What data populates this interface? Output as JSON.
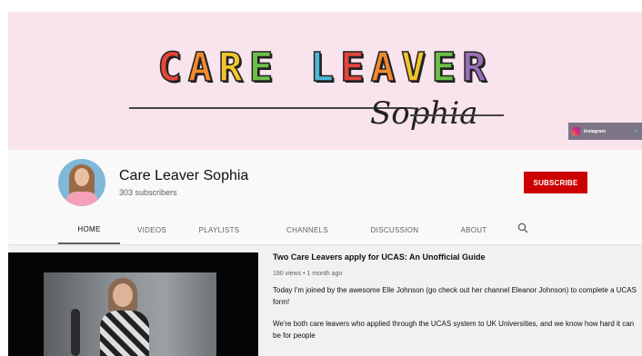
{
  "banner": {
    "title_letters": [
      {
        "char": "C",
        "color": "#e5453b"
      },
      {
        "char": "A",
        "color": "#f28a2e"
      },
      {
        "char": "R",
        "color": "#f2c52c"
      },
      {
        "char": "E",
        "color": "#6cc04a"
      },
      {
        "char": " ",
        "color": "#000000"
      },
      {
        "char": "L",
        "color": "#4fb7d8"
      },
      {
        "char": "E",
        "color": "#e5453b"
      },
      {
        "char": "A",
        "color": "#f28a2e"
      },
      {
        "char": "V",
        "color": "#f2c52c"
      },
      {
        "char": "E",
        "color": "#6cc04a"
      },
      {
        "char": "R",
        "color": "#9a6fb8"
      }
    ],
    "signature": "Sophia",
    "background": "#f9e3ed"
  },
  "social": {
    "instagram_label": "Instagram",
    "icons": [
      "instagram-icon",
      "twitter-icon"
    ]
  },
  "channel": {
    "name": "Care Leaver Sophia",
    "subscribers": "303 subscribers",
    "subscribe_label": "SUBSCRIBE",
    "subscribe_color": "#cc0000"
  },
  "tabs": [
    {
      "label": "HOME",
      "active": true
    },
    {
      "label": "VIDEOS",
      "active": false
    },
    {
      "label": "PLAYLISTS",
      "active": false
    },
    {
      "label": "CHANNELS",
      "active": false
    },
    {
      "label": "DISCUSSION",
      "active": false
    },
    {
      "label": "ABOUT",
      "active": false
    }
  ],
  "featured_video": {
    "title": "Two Care Leavers apply for UCAS: An Unofficial Guide",
    "meta": "190 views • 1 month ago",
    "description": [
      "Today I'm joined by the awesome Elle Johnson (go check out her channel Eleanor Johnson) to complete a UCAS form!",
      "We're both care leavers who applied through the UCAS system to UK Universities, and we know how hard it can be for people"
    ]
  }
}
